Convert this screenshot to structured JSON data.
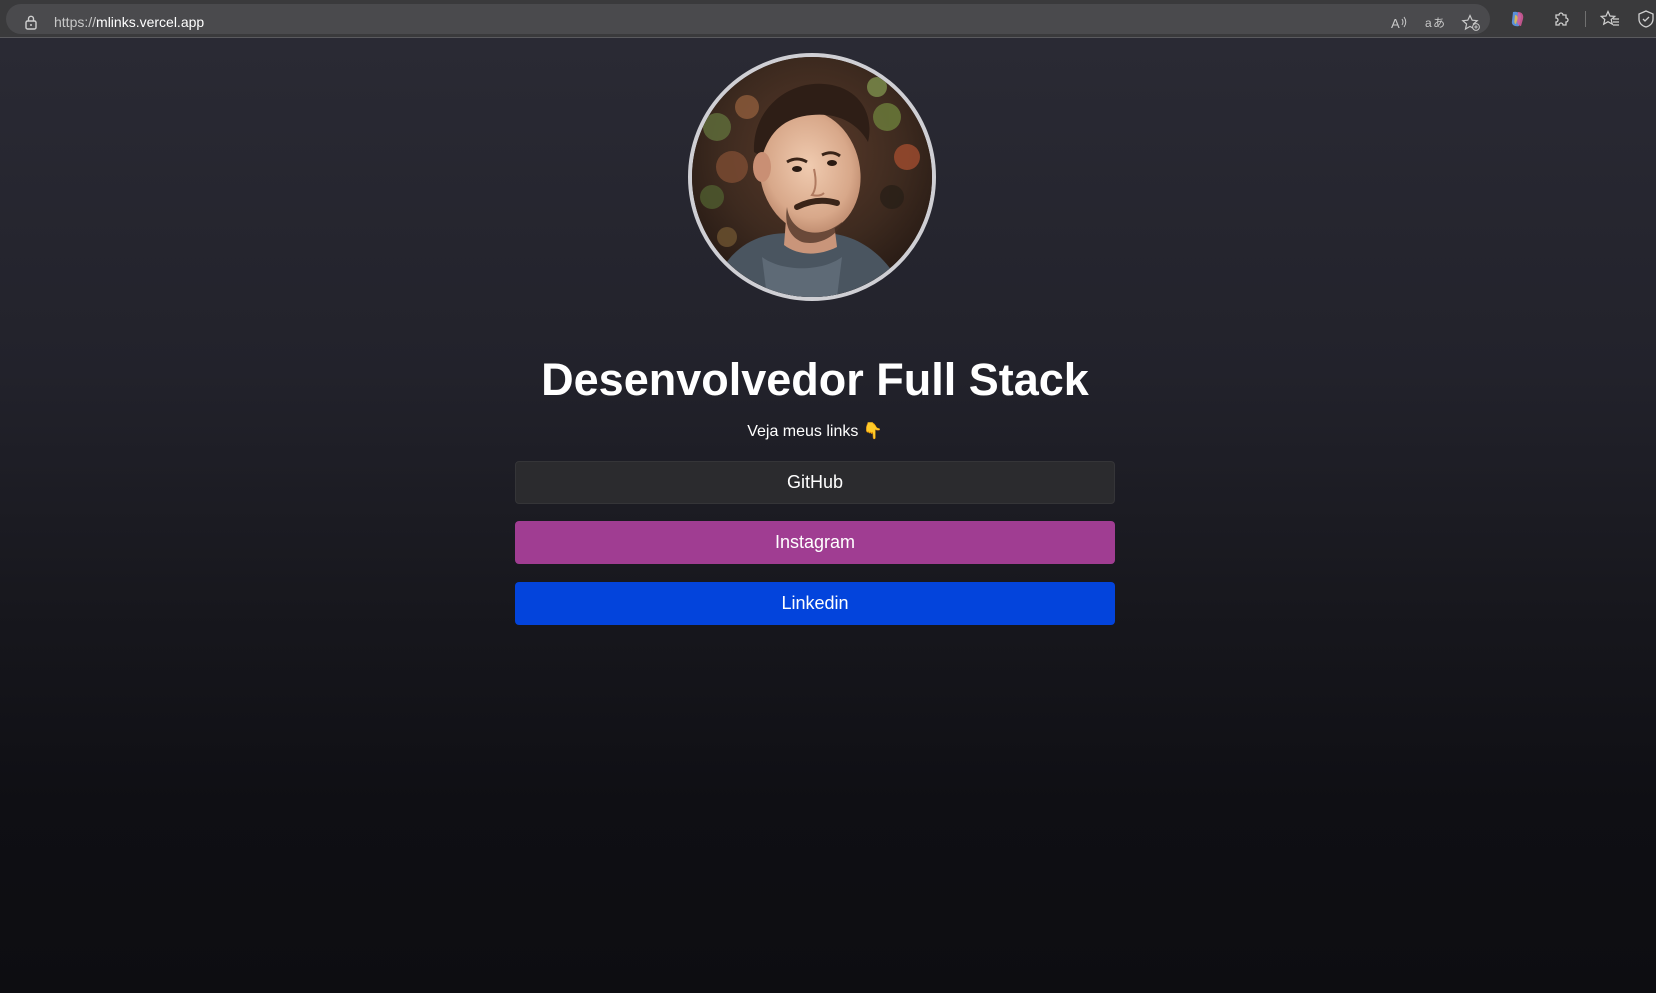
{
  "browser": {
    "url_scheme": "https://",
    "url_host": "mlinks.vercel.app",
    "icons": [
      "lock-icon",
      "read-aloud-icon",
      "translate-icon",
      "favorite-add-icon",
      "copilot-icon",
      "extensions-icon",
      "favorites-icon",
      "browser-essentials-icon"
    ]
  },
  "profile": {
    "title": "Desenvolvedor Full Stack",
    "subtitle": "Veja meus links",
    "subtitle_emoji": "👇"
  },
  "links": [
    {
      "label": "GitHub",
      "color": "#2b2b2e"
    },
    {
      "label": "Instagram",
      "color": "#a03d92"
    },
    {
      "label": "Linkedin",
      "color": "#0344dc"
    }
  ],
  "colors": {
    "background_top": "#2a2a34",
    "background_bottom": "#0d0d11",
    "avatar_ring": "#cfcfd4"
  }
}
